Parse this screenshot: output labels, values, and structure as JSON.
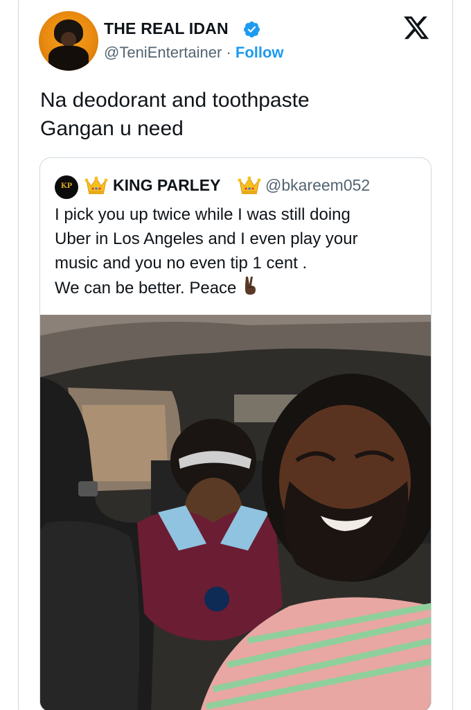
{
  "author": {
    "display_name": "THE REAL IDAN",
    "handle": "@TeniEntertainer",
    "separator": "·",
    "follow_label": "Follow"
  },
  "tweet": {
    "text_lines": [
      "Na deodorant and toothpaste",
      "Gangan u need"
    ]
  },
  "quoted_tweet": {
    "avatar_text": "KP",
    "display_name": "KING PARLEY",
    "handle": "@bkareem052",
    "text_lines": [
      "I pick you up twice while I was still doing",
      "Uber in Los Angeles and I even play your",
      "music and you no even tip 1 cent .",
      "We can be better. Peace"
    ],
    "emoji": "victory-hand-dark-skin-tone"
  },
  "colors": {
    "link_blue": "#1d9bf0",
    "secondary_text": "#536471",
    "border": "#cfd9de",
    "verified_badge": "#1d9bf0"
  },
  "icons": {
    "verified": "verified-badge-icon",
    "platform": "x-logo-icon",
    "crown": "crown-emoji-icon",
    "peace": "victory-hand-emoji"
  }
}
